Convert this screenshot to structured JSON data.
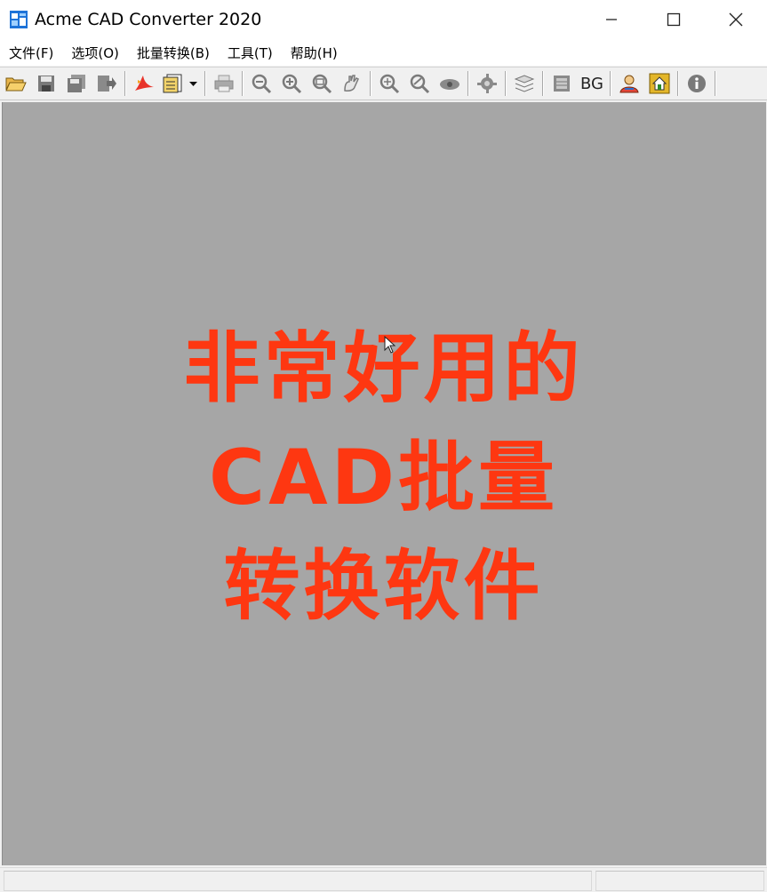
{
  "window": {
    "title": "Acme CAD Converter 2020",
    "icon": "app-icon",
    "controls": [
      "minimize-icon",
      "maximize-icon",
      "close-icon"
    ]
  },
  "menu": [
    {
      "label": "文件(F)"
    },
    {
      "label": "选项(O)"
    },
    {
      "label": "批量转换(B)"
    },
    {
      "label": "工具(T)"
    },
    {
      "label": "帮助(H)"
    }
  ],
  "toolbar": {
    "bg_label": "BG",
    "icons": [
      "open-folder-icon",
      "save-icon",
      "save-all-icon",
      "export-icon",
      "pdf-convert-icon",
      "batch-convert-icon",
      "print-icon",
      "zoom-out-icon",
      "zoom-in-icon",
      "zoom-window-icon",
      "pan-icon",
      "zoom-extents-icon",
      "zoom-realtime-icon",
      "view-icon",
      "layers-icon",
      "pages-icon",
      "background-icon",
      "home-icon",
      "info-icon"
    ]
  },
  "overlay": {
    "line1": "非常好用的",
    "line2": "CAD批量",
    "line3": "转换软件",
    "color": "#fe3711"
  },
  "colors": {
    "workspace": "#a6a6a6",
    "chrome": "#f0f0f0"
  }
}
